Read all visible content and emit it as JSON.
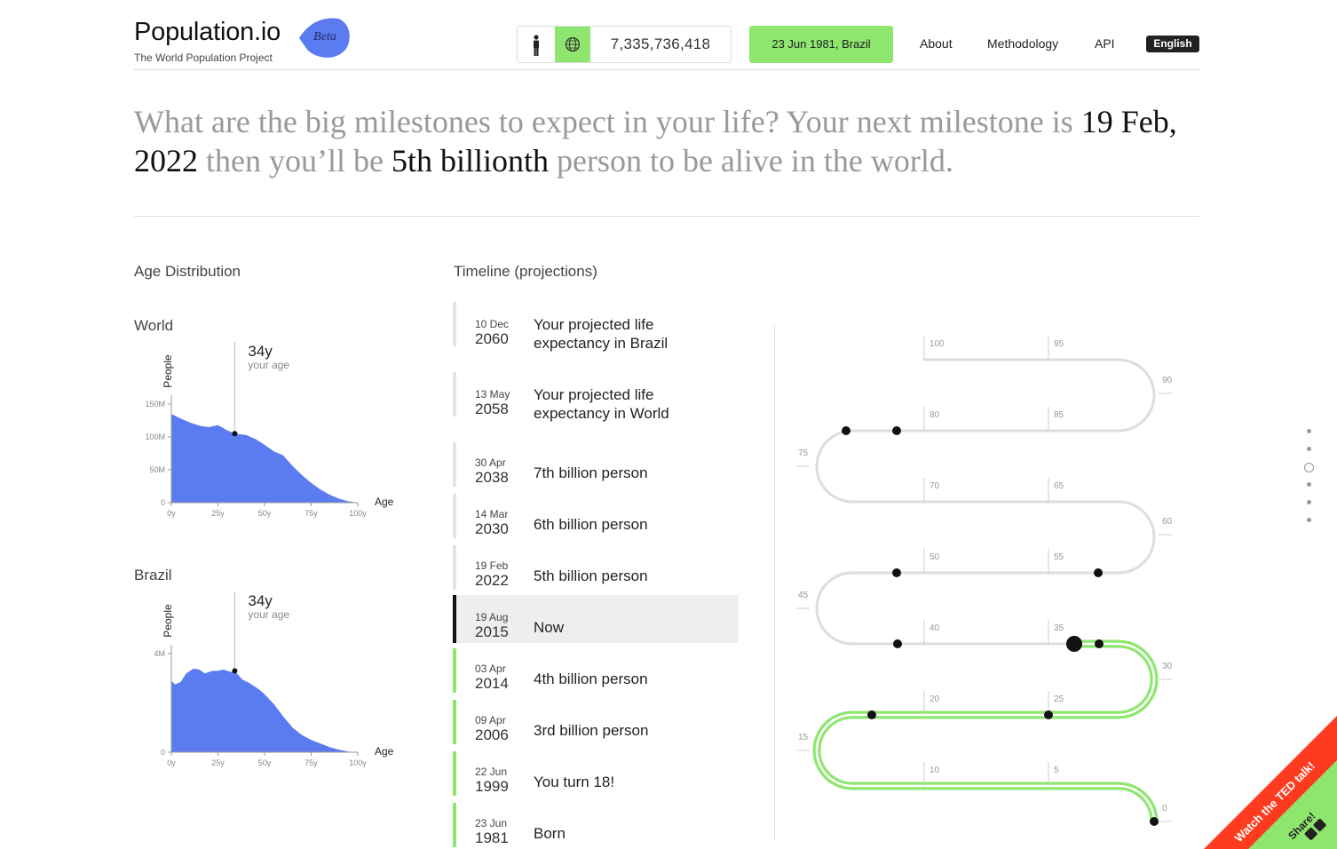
{
  "header": {
    "logo_title": "Population.io",
    "logo_subtitle": "The World Population Project",
    "beta_label": "Beta",
    "person_icon": "person-icon",
    "globe_icon": "globe-icon",
    "population_count": "7,335,736,418",
    "birth_selection": "23 Jun 1981, Brazil",
    "nav": [
      "About",
      "Methodology",
      "API"
    ],
    "language": "English",
    "accent_color": "#8ee66f",
    "beta_color": "#5b7cf0"
  },
  "headline": {
    "part1": "What are the big milestones to expect in your life? Your next milestone is ",
    "date": "19 Feb, 2022",
    "part2": " then you’ll be ",
    "milestone": "5th billionth",
    "part3": " person to be alive in the world."
  },
  "age_distribution": {
    "title": "Age Distribution",
    "charts_meta": [
      {
        "label": "World",
        "age_value": "34y",
        "age_caption": "your age",
        "ylabel": "People",
        "xlabel": "Age"
      },
      {
        "label": "Brazil",
        "age_value": "34y",
        "age_caption": "your age",
        "ylabel": "People",
        "xlabel": "Age"
      }
    ]
  },
  "chart_data": [
    {
      "type": "area",
      "title": "World",
      "xlabel": "Age",
      "ylabel": "People",
      "x_ticks": [
        "0y",
        "25y",
        "50y",
        "75y",
        "100y"
      ],
      "y_ticks": [
        "0",
        "50M",
        "100M",
        "150M"
      ],
      "xlim": [
        0,
        100
      ],
      "ylim": [
        0,
        150
      ],
      "marker": {
        "x": 34,
        "y": 105
      },
      "series": [
        {
          "x": [
            0,
            5,
            10,
            15,
            20,
            25,
            30,
            34,
            40,
            45,
            50,
            55,
            60,
            65,
            70,
            75,
            80,
            85,
            90,
            95,
            100
          ],
          "y": [
            135,
            128,
            122,
            117,
            115,
            118,
            110,
            105,
            103,
            97,
            88,
            78,
            72,
            56,
            42,
            30,
            20,
            12,
            6,
            2,
            0
          ]
        }
      ],
      "color": "#5b7cf0"
    },
    {
      "type": "area",
      "title": "Brazil",
      "xlabel": "Age",
      "ylabel": "People",
      "x_ticks": [
        "0y",
        "25y",
        "50y",
        "75y",
        "100y"
      ],
      "y_ticks": [
        "0",
        "4M"
      ],
      "xlim": [
        0,
        100
      ],
      "ylim": [
        0,
        4
      ],
      "marker": {
        "x": 34,
        "y": 3.3
      },
      "series": [
        {
          "x": [
            0,
            2,
            5,
            8,
            12,
            15,
            18,
            22,
            25,
            28,
            32,
            34,
            38,
            42,
            47,
            50,
            55,
            60,
            65,
            70,
            75,
            80,
            85,
            90,
            95,
            100
          ],
          "y": [
            2.9,
            2.75,
            2.85,
            3.2,
            3.4,
            3.35,
            3.2,
            3.3,
            3.3,
            3.35,
            3.25,
            3.3,
            2.95,
            2.8,
            2.55,
            2.35,
            1.95,
            1.45,
            1.0,
            0.7,
            0.5,
            0.35,
            0.2,
            0.1,
            0.03,
            0
          ]
        }
      ],
      "color": "#5b7cf0"
    }
  ],
  "timeline": {
    "title": "Timeline (projections)",
    "items": [
      {
        "day": "10 Dec",
        "year": "2060",
        "label": "Your projected life expectancy in Brazil",
        "state": "future"
      },
      {
        "day": "13 May",
        "year": "2058",
        "label": "Your projected life expectancy in World",
        "state": "future"
      },
      {
        "day": "30 Apr",
        "year": "2038",
        "label": "7th billion person",
        "state": "future"
      },
      {
        "day": "14 Mar",
        "year": "2030",
        "label": "6th billion person",
        "state": "future"
      },
      {
        "day": "19 Feb",
        "year": "2022",
        "label": "5th billion person",
        "state": "future"
      },
      {
        "day": "19 Aug",
        "year": "2015",
        "label": "Now",
        "state": "now"
      },
      {
        "day": "03 Apr",
        "year": "2014",
        "label": "4th billion person",
        "state": "past"
      },
      {
        "day": "09 Apr",
        "year": "2006",
        "label": "3rd billion person",
        "state": "past"
      },
      {
        "day": "22 Jun",
        "year": "1999",
        "label": "You turn 18!",
        "state": "past"
      },
      {
        "day": "23 Jun",
        "year": "1981",
        "label": "Born",
        "state": "past"
      }
    ]
  },
  "life_path": {
    "age_labels": [
      "100",
      "95",
      "90",
      "80",
      "85",
      "75",
      "70",
      "65",
      "60",
      "50",
      "55",
      "45",
      "40",
      "35",
      "30",
      "20",
      "25",
      "15",
      "10",
      "5",
      "0"
    ],
    "current_age": 34
  },
  "ribbon": {
    "ted_label": "Watch the TED talk!",
    "share_label": "Share!",
    "color": "#ff3b1f"
  }
}
